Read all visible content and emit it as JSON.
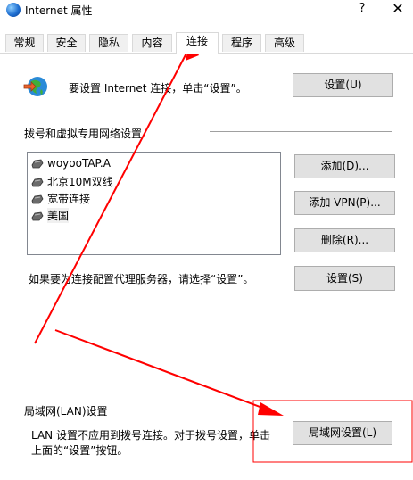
{
  "window": {
    "title": "Internet 属性",
    "help_label": "?",
    "close_label": "✕",
    "app_icon": "internet-options-icon"
  },
  "tabs": [
    {
      "label": "常规",
      "active": false
    },
    {
      "label": "安全",
      "active": false
    },
    {
      "label": "隐私",
      "active": false
    },
    {
      "label": "内容",
      "active": false
    },
    {
      "label": "连接",
      "active": true
    },
    {
      "label": "程序",
      "active": false
    },
    {
      "label": "高级",
      "active": false
    }
  ],
  "setup": {
    "text": "要设置 Internet 连接，单击“设置”。",
    "button": "设置(U)",
    "icon": "globe-connect-icon"
  },
  "dialup": {
    "heading": "拨号和虚拟专用网络设置",
    "connections": [
      {
        "name": "woyooTAP.A",
        "icon": "network-connection-icon"
      },
      {
        "name": "北京10M双线",
        "icon": "network-connection-icon"
      },
      {
        "name": "宽带连接",
        "icon": "network-connection-icon"
      },
      {
        "name": "美国",
        "icon": "network-connection-icon",
        "selected": true
      }
    ],
    "add_button": "添加(D)...",
    "add_vpn_button": "添加 VPN(P)...",
    "remove_button": "删除(R)...",
    "proxy_text": "如果要为连接配置代理服务器，请选择“设置”。",
    "settings_button": "设置(S)"
  },
  "lan": {
    "heading": "局域网(LAN)设置",
    "text_line1": "LAN 设置不应用到拨号连接。对于拨号设置，单击",
    "text_line2": "上面的“设置”按钮。",
    "button": "局域网设置(L)"
  },
  "annotation": {
    "color": "#ff0000"
  }
}
